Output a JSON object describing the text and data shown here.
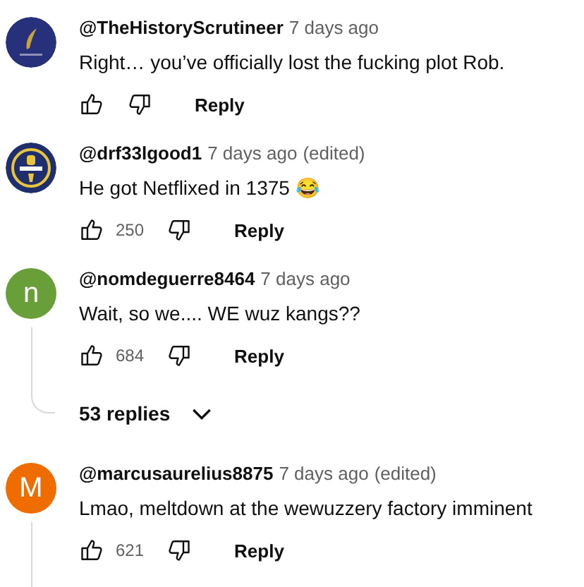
{
  "comments": [
    {
      "author": "@TheHistoryScrutineer",
      "time": "7 days ago",
      "text": "Right… you’ve officially lost the fucking plot Rob.",
      "reply_label": "Reply"
    },
    {
      "author": "@drf33lgood1",
      "time": "7 days ago",
      "edited_label": "(edited)",
      "text": "He got Netflixed in 1375 😂",
      "likes": "250",
      "reply_label": "Reply"
    },
    {
      "avatar": {
        "kind": "letter",
        "letter": "n",
        "color": "#689f38"
      },
      "author": "@nomdeguerre8464",
      "time": "7 days ago",
      "text": "Wait, so we.... WE wuz kangs??",
      "likes": "684",
      "reply_label": "Reply",
      "thread_line": true,
      "replies": "53 replies"
    },
    {
      "avatar": {
        "kind": "letter",
        "letter": "M",
        "color": "#ef6c00"
      },
      "author": "@marcusaurelius8875",
      "time": "7 days ago",
      "edited_label": "(edited)",
      "text": "Lmao, meltdown at the wewuzzery factory imminent",
      "likes": "621",
      "reply_label": "Reply",
      "thread_line": true
    }
  ]
}
